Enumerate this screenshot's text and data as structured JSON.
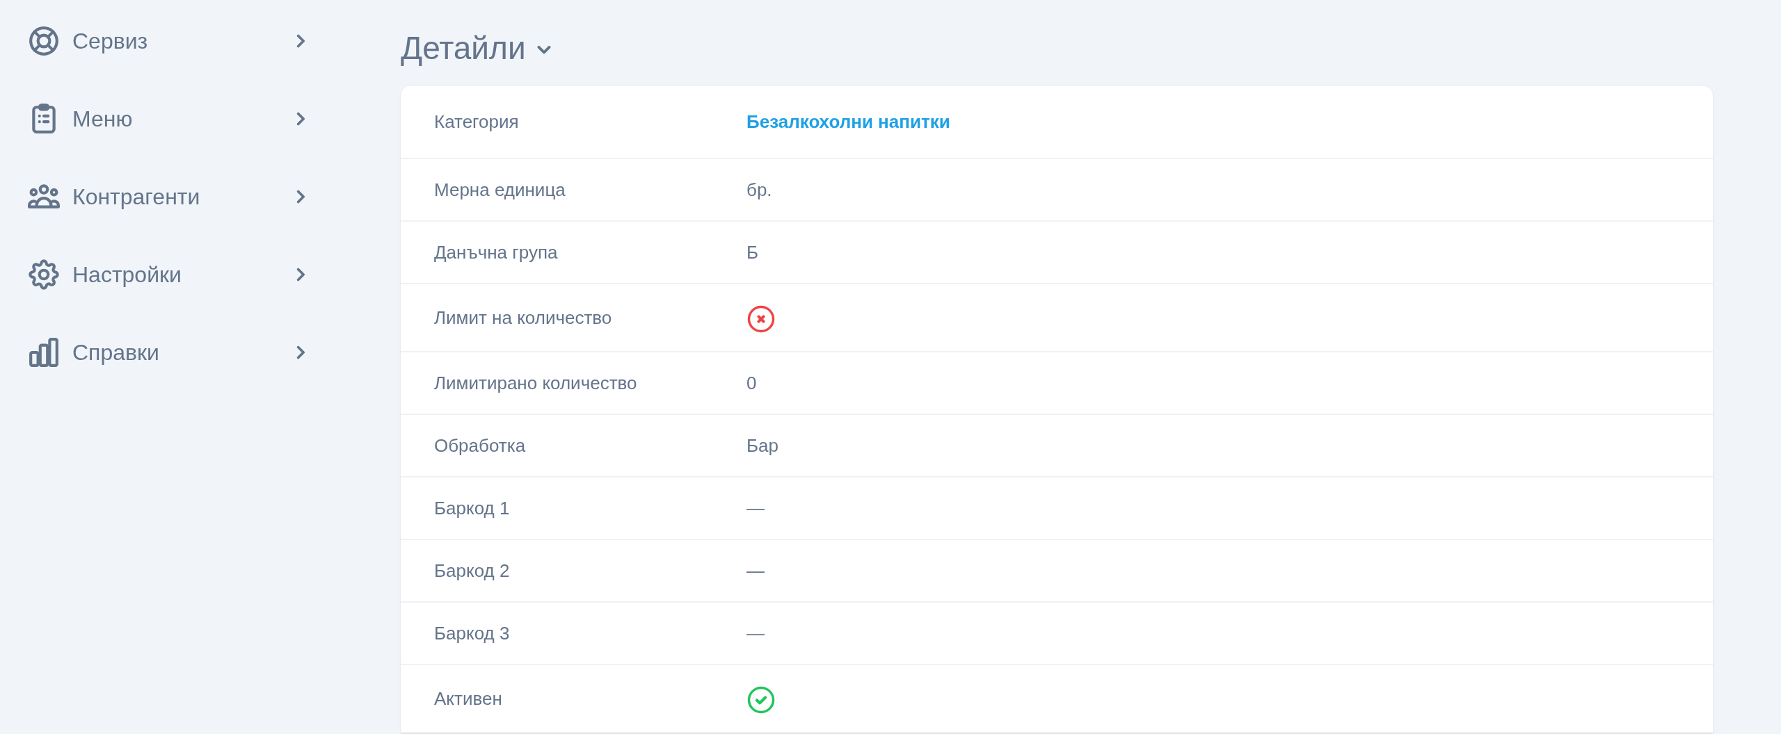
{
  "sidebar": {
    "items": [
      {
        "label": "Сервиз"
      },
      {
        "label": "Меню"
      },
      {
        "label": "Контрагенти"
      },
      {
        "label": "Настройки"
      },
      {
        "label": "Справки"
      }
    ]
  },
  "section": {
    "title": "Детайли",
    "expanded": true
  },
  "details": [
    {
      "label": "Категория",
      "kind": "link",
      "value": "Безалкохолни напитки"
    },
    {
      "label": "Мерна единица",
      "kind": "text",
      "value": "бр."
    },
    {
      "label": "Данъчна група",
      "kind": "text",
      "value": "Б"
    },
    {
      "label": "Лимит на количество",
      "kind": "bool",
      "value": false
    },
    {
      "label": "Лимитирано количество",
      "kind": "text",
      "value": "0"
    },
    {
      "label": "Обработка",
      "kind": "text",
      "value": "Бар"
    },
    {
      "label": "Баркод 1",
      "kind": "text",
      "value": "—"
    },
    {
      "label": "Баркод 2",
      "kind": "text",
      "value": "—"
    },
    {
      "label": "Баркод 3",
      "kind": "text",
      "value": "—"
    },
    {
      "label": "Активен",
      "kind": "bool",
      "value": true
    }
  ]
}
